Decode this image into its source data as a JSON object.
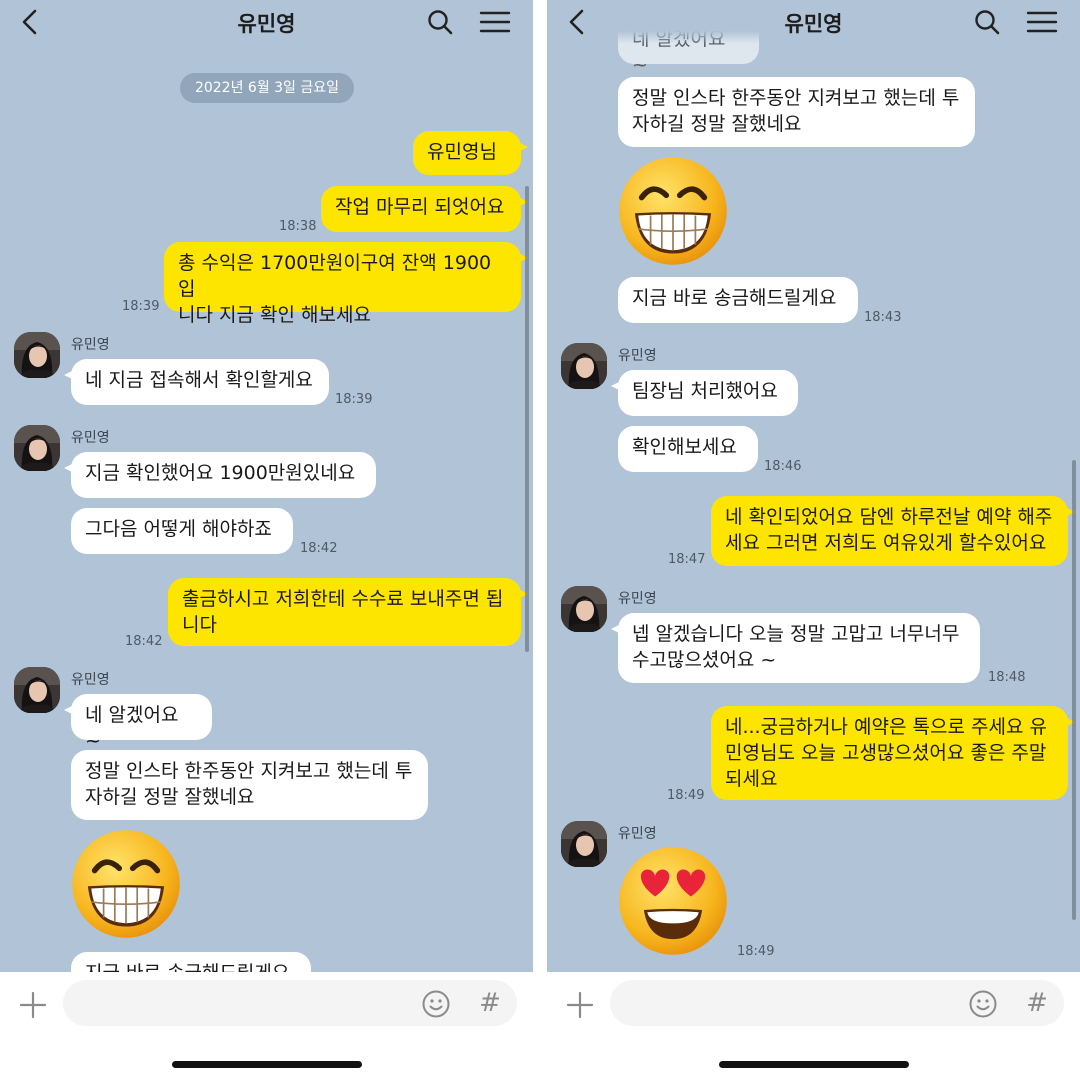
{
  "left": {
    "header": {
      "title": "유민영"
    },
    "date_divider": "2022년 6월 3일 금요일",
    "messages": [
      {
        "text": "유민영님"
      },
      {
        "text": "작업 마무리 되엇어요",
        "time": "18:38"
      },
      {
        "line1": "총 수익은 1700만원이구여 잔액 1900입",
        "line2": "니다 지금 확인 해보세요",
        "time": "18:39"
      },
      {
        "sender": "유민영",
        "text": "네 지금 접속해서 확인할게요",
        "time": "18:39"
      },
      {
        "sender": "유민영",
        "text": "지금 확인했어요 1900만원있네요"
      },
      {
        "text": "그다음 어떻게 해야하죠",
        "time": "18:42"
      },
      {
        "line1": "출금하시고 저희한테 수수료 보내주면 됩",
        "line2": "니다",
        "time": "18:42"
      },
      {
        "sender": "유민영",
        "text": "네 알겠어요 ~"
      },
      {
        "line1": "정말 인스타 한주동안 지켜보고 했는데 투",
        "line2": "자하길 정말 잘했네요"
      },
      {
        "sticker": "grinning-face-emoji"
      },
      {
        "text": "지금 바로 송금해드릴게요"
      }
    ],
    "input": {
      "placeholder": ""
    }
  },
  "right": {
    "header": {
      "title": "유민영"
    },
    "messages": [
      {
        "text": "네 알겠어요 ~"
      },
      {
        "line1": "정말 인스타 한주동안 지켜보고 했는데 투",
        "line2": "자하길 정말 잘했네요"
      },
      {
        "sticker": "grinning-face-emoji"
      },
      {
        "text": "지금 바로 송금해드릴게요",
        "time": "18:43"
      },
      {
        "sender": "유민영",
        "text": "팀장님 처리했어요"
      },
      {
        "text": "확인해보세요",
        "time": "18:46"
      },
      {
        "line1": "네 확인되었어요 담엔 하루전날 예약 해주",
        "line2": "세요 그러면 저희도 여유있게 할수있어요",
        "time": "18:47"
      },
      {
        "sender": "유민영",
        "line1": "넵 알겠습니다 오늘 정말 고맙고 너무너무",
        "line2": "수고많으셨어요 ~",
        "time": "18:48"
      },
      {
        "line1": "네...궁금하거나 예약은 톡으로 주세요 유",
        "line2": "민영님도 오늘 고생많으셨어요 좋은 주말",
        "line3": "되세요",
        "time": "18:49"
      },
      {
        "sender": "유민영",
        "sticker": "heart-eyes-emoji",
        "time": "18:49"
      }
    ],
    "input": {
      "placeholder": ""
    }
  }
}
